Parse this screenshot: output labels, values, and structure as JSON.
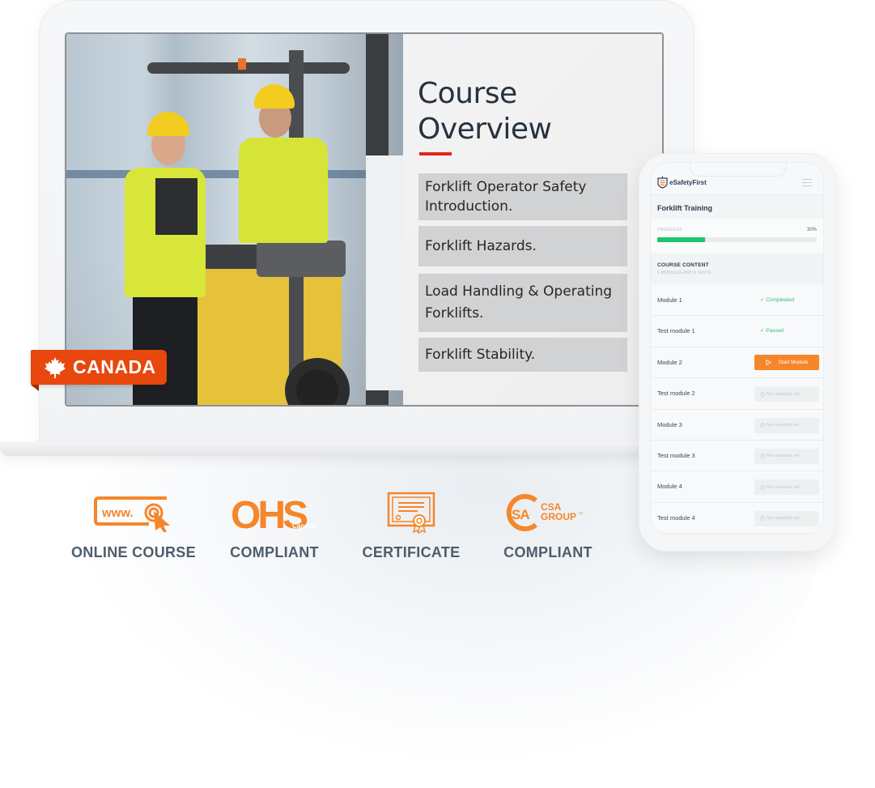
{
  "laptop": {
    "course_overview": {
      "title_line1": "Course",
      "title_line2": "Overview",
      "topics": [
        "Forklift Operator Safety Introduction.",
        "Forklift Hazards.",
        "Load Handling & Operating Forklifts.",
        "Forklift Stability."
      ]
    },
    "region_tag": {
      "label": "CANADA",
      "icon": "maple-leaf-icon"
    },
    "photo": {
      "description": "Two workers in hard hats and hi-vis vests beside a yellow forklift in a warehouse"
    }
  },
  "badges": [
    {
      "icon": "www-click-icon",
      "label": "ONLINE COURSE"
    },
    {
      "icon": "ohs-canada-logo",
      "label": "COMPLIANT",
      "icon_text": "OHS",
      "icon_subtext": "Canada"
    },
    {
      "icon": "certificate-icon",
      "label": "CERTIFICATE"
    },
    {
      "icon": "csa-group-logo",
      "label": "COMPLIANT",
      "icon_text": "CSA GROUP"
    }
  ],
  "phone": {
    "brand": "eSafetyFirst",
    "course_title": "Forklift Training",
    "progress_label": "PROGRESS",
    "progress_percent": 30,
    "progress_text": "30%",
    "content_title": "COURSE CONTENT",
    "content_subtitle": "6 MODULES AND 6 TESTS",
    "modules": [
      {
        "name": "Module 1",
        "status": "done",
        "status_label": "Compleated"
      },
      {
        "name": "Test module 1",
        "status": "done",
        "status_label": "Passed"
      },
      {
        "name": "Module 2",
        "status": "start",
        "status_label": "Start Module"
      },
      {
        "name": "Test module 2",
        "status": "na",
        "status_label": "Not available yet"
      },
      {
        "name": "Module 3",
        "status": "na",
        "status_label": "Not available yet"
      },
      {
        "name": "Test module 3",
        "status": "na",
        "status_label": "Not available yet"
      },
      {
        "name": "Module 4",
        "status": "na",
        "status_label": "Not available yet"
      },
      {
        "name": "Test module 4",
        "status": "na",
        "status_label": "Not available yet"
      }
    ]
  },
  "colors": {
    "accent_orange": "#f5862a",
    "tag_orange": "#e8470e",
    "underline_red": "#e1261c",
    "progress_green": "#1dc36d",
    "status_green": "#39c07a",
    "label_slate": "#4f5d6a"
  }
}
